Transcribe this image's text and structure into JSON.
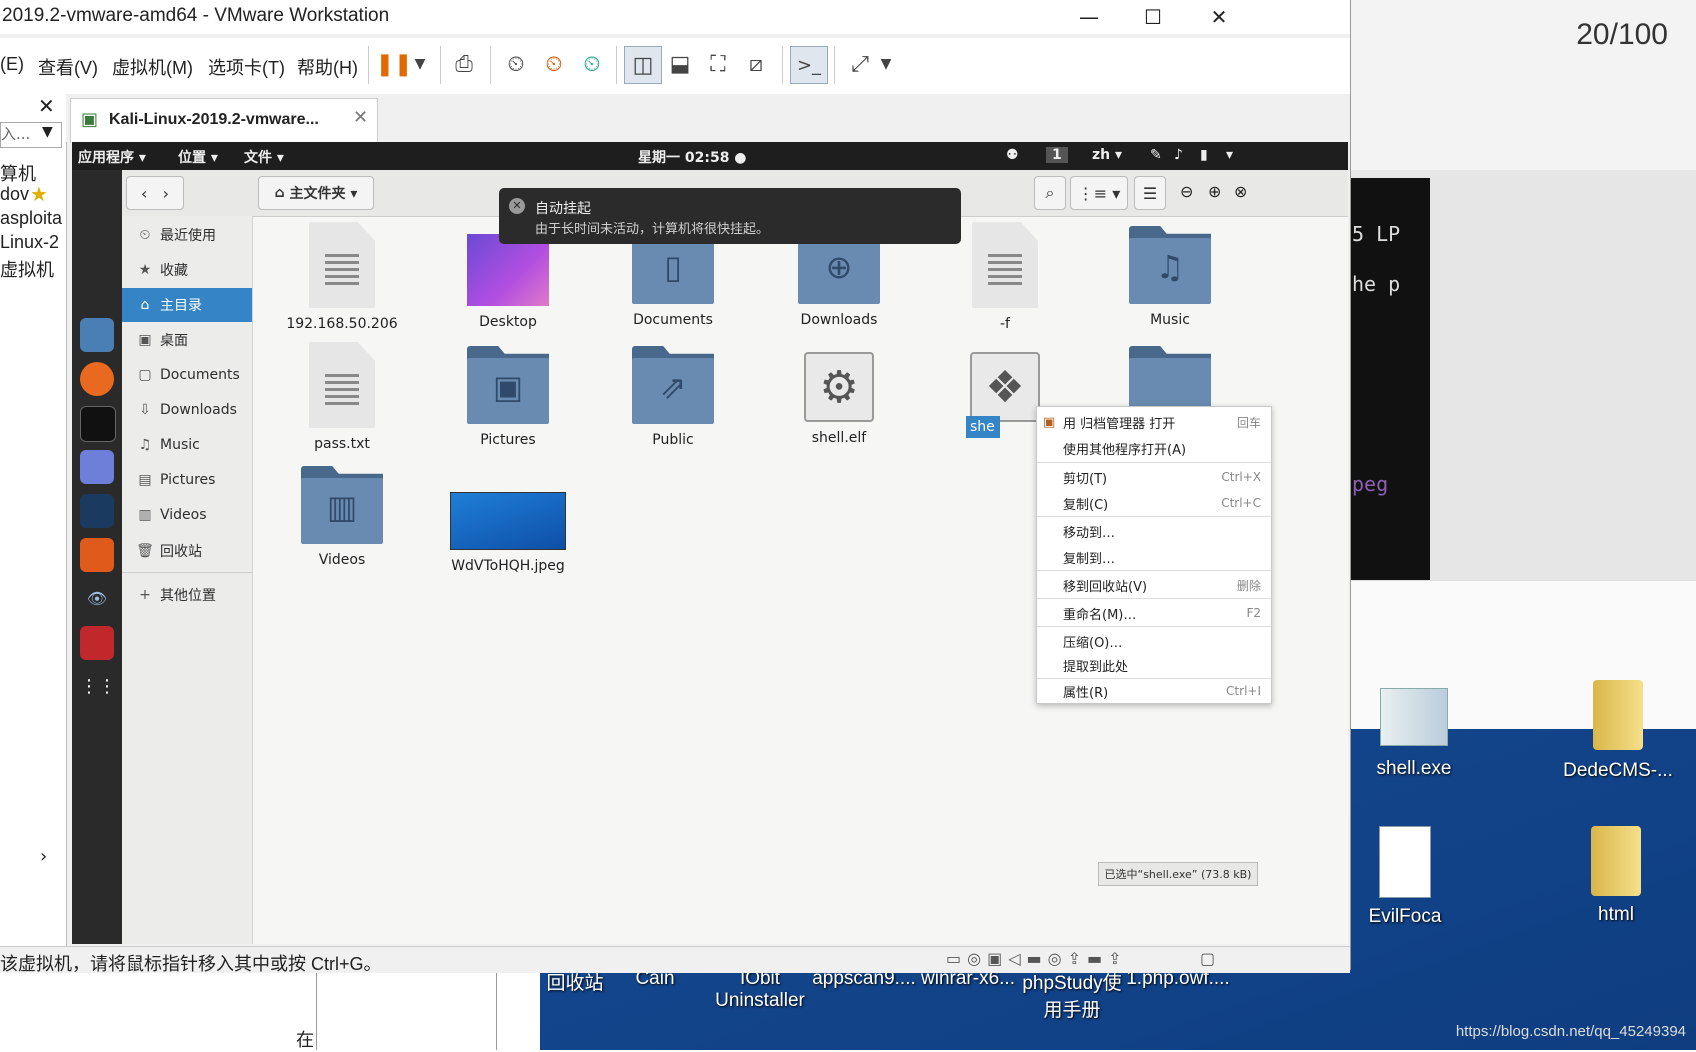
{
  "vmware": {
    "title": "2019.2-vmware-amd64 - VMware Workstation",
    "menu": [
      "(E)",
      "查看(V)",
      "虚拟机(M)",
      "选项卡(T)",
      "帮助(H)"
    ],
    "tab_label": "Kali-Linux-2019.2-vmware...",
    "status_message": "该虚拟机，请将鼠标指针移入其中或按 Ctrl+G。",
    "library_search_placeholder": "入...",
    "library_items": [
      "算机",
      "dov",
      "asploita",
      "Linux-2",
      "虚拟机"
    ]
  },
  "kali": {
    "topbar": {
      "apps": "应用程序 ▾",
      "places": "位置 ▾",
      "files": "文件 ▾",
      "clock": "星期一 02:58 ●",
      "workspace": "1",
      "lang": "zh ▾"
    },
    "path_button": "主文件夹 ▾",
    "sidebar": [
      {
        "icon": "⏲",
        "label": "最近使用"
      },
      {
        "icon": "★",
        "label": "收藏"
      },
      {
        "icon": "⌂",
        "label": "主目录"
      },
      {
        "icon": "▣",
        "label": "桌面"
      },
      {
        "icon": "▢",
        "label": "Documents"
      },
      {
        "icon": "⇩",
        "label": "Downloads"
      },
      {
        "icon": "♫",
        "label": "Music"
      },
      {
        "icon": "▤",
        "label": "Pictures"
      },
      {
        "icon": "▥",
        "label": "Videos"
      },
      {
        "icon": "🗑",
        "label": "回收站"
      },
      {
        "icon": "+",
        "label": "其他位置"
      }
    ],
    "files": [
      {
        "name": "192.168.50.206"
      },
      {
        "name": "Desktop"
      },
      {
        "name": "Documents"
      },
      {
        "name": "Downloads"
      },
      {
        "name": "-f"
      },
      {
        "name": "Music"
      },
      {
        "name": "pass.txt"
      },
      {
        "name": "Pictures"
      },
      {
        "name": "Public"
      },
      {
        "name": "shell.elf"
      },
      {
        "name": "she"
      },
      {
        "name": "Videos"
      },
      {
        "name": "WdVToHQH.jpeg"
      }
    ],
    "notification": {
      "title": "自动挂起",
      "body": "由于长时间未活动，计算机将很快挂起。"
    },
    "context_menu": [
      {
        "label": "用 归档管理器 打开",
        "shortcut": "回车"
      },
      {
        "label": "使用其他程序打开(A)",
        "shortcut": ""
      },
      {
        "label": "剪切(T)",
        "shortcut": "Ctrl+X"
      },
      {
        "label": "复制(C)",
        "shortcut": "Ctrl+C"
      },
      {
        "label": "移动到…",
        "shortcut": ""
      },
      {
        "label": "复制到…",
        "shortcut": ""
      },
      {
        "label": "移到回收站(V)",
        "shortcut": "删除"
      },
      {
        "label": "重命名(M)…",
        "shortcut": "F2"
      },
      {
        "label": "压缩(O)…",
        "shortcut": ""
      },
      {
        "label": "提取到此处",
        "shortcut": ""
      },
      {
        "label": "属性(R)",
        "shortcut": "Ctrl+I"
      }
    ],
    "selection_status": "已选中“shell.exe” (73.8 kB)"
  },
  "host": {
    "counter": "20/100",
    "terminal_lines": [
      "5 LP",
      "he p",
      "peg"
    ],
    "desktop_icons": [
      {
        "label": "shell.exe"
      },
      {
        "label": "DedeCMS-..."
      },
      {
        "label": "EvilFoca"
      },
      {
        "label": "html"
      }
    ],
    "taskbar_labels": [
      "回收站",
      "Cain",
      "IObit Uninstaller",
      "appscan9....",
      "winrar-x6...",
      "phpStudy使用手册",
      "1.php.owf...."
    ],
    "watermark": "https://blog.csdn.net/qq_45249394",
    "bottom_left_char": "在"
  },
  "colors": {
    "selection": "#3584c5",
    "gnome_bar": "#1e1e1e",
    "desktop_blue": "#1f5fae"
  }
}
